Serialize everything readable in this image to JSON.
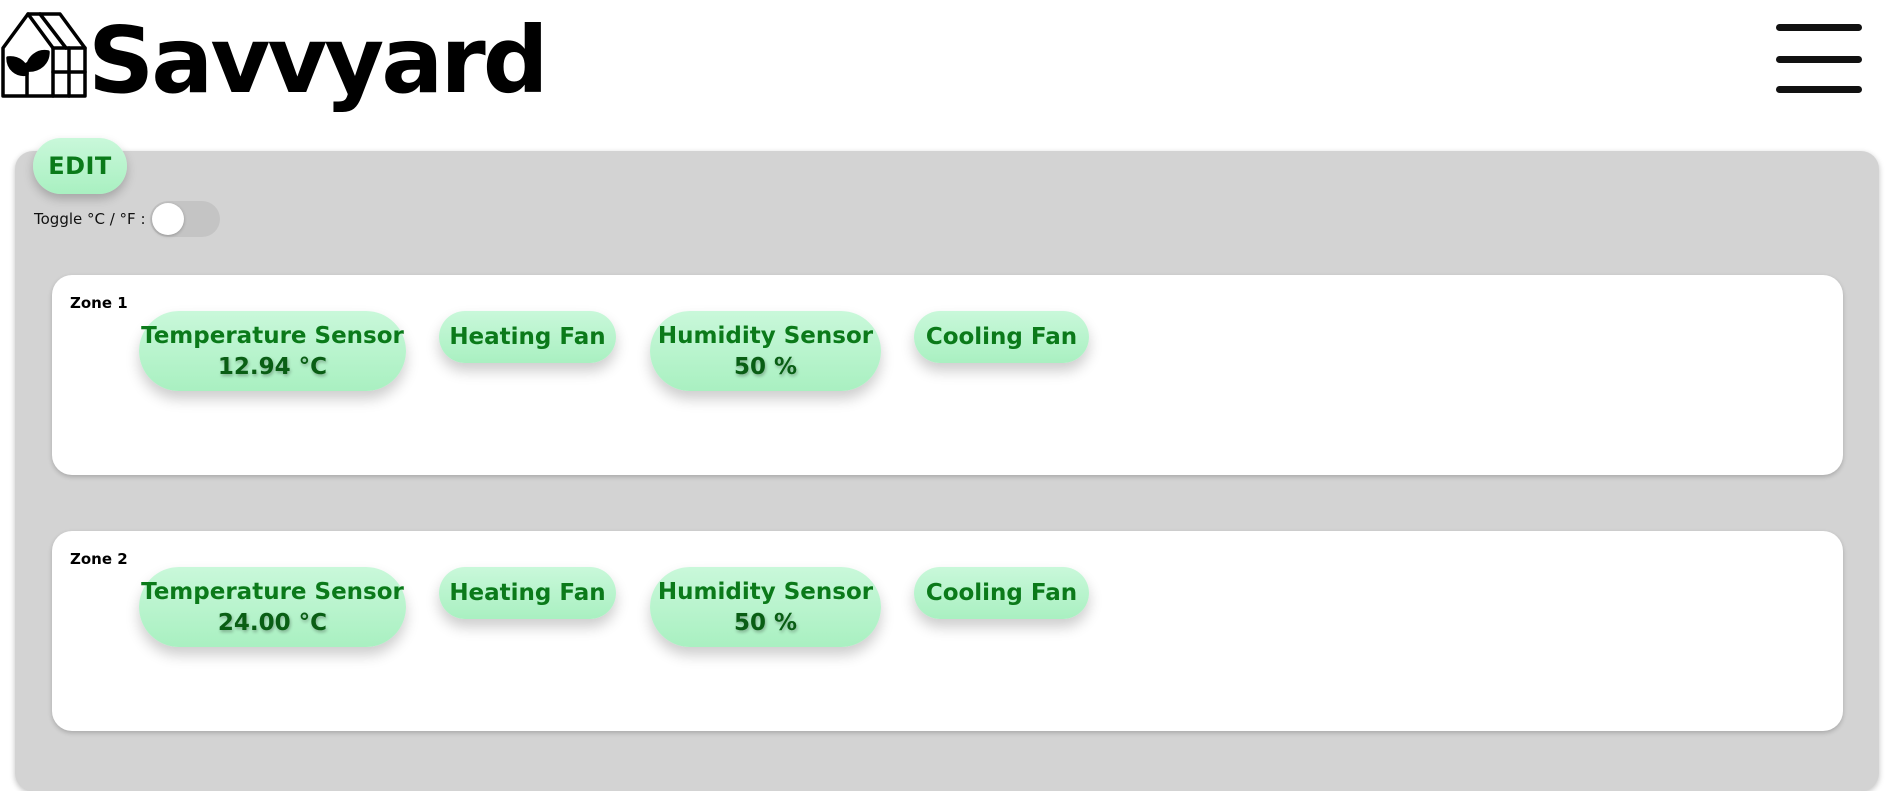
{
  "app": {
    "brand": "Savvyard"
  },
  "header": {
    "logo_icon": "greenhouse-leaf-icon",
    "menu_icon": "hamburger-menu-icon"
  },
  "controls": {
    "edit_label": "EDIT",
    "toggle_label": "Toggle °C / °F :",
    "toggle_state": "off"
  },
  "colors": {
    "panel_bg": "#d3d3d3",
    "device_bg": "#b5f3ca",
    "device_text": "#0b7a1a",
    "toggle_track": "#c4c4c4"
  },
  "zones": [
    {
      "label": "Zone 1",
      "devices": [
        {
          "name": "Temperature Sensor",
          "value": "12.94 °C"
        },
        {
          "name": "Heating Fan"
        },
        {
          "name": "Humidity Sensor",
          "value": "50 %"
        },
        {
          "name": "Cooling Fan"
        }
      ]
    },
    {
      "label": "Zone 2",
      "devices": [
        {
          "name": "Temperature Sensor",
          "value": "24.00 °C"
        },
        {
          "name": "Heating Fan"
        },
        {
          "name": "Humidity Sensor",
          "value": "50 %"
        },
        {
          "name": "Cooling Fan"
        }
      ]
    }
  ]
}
